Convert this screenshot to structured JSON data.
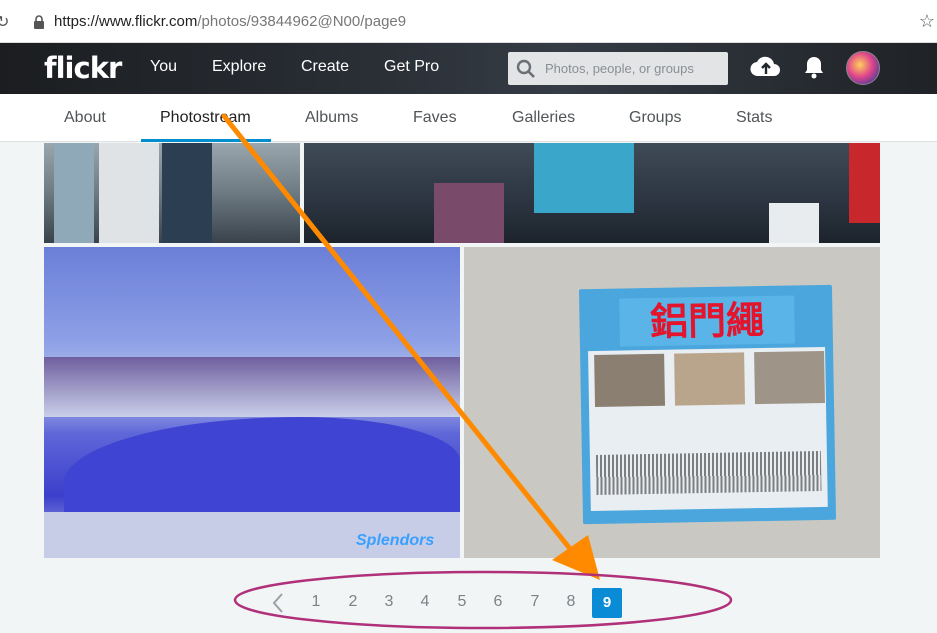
{
  "browser": {
    "url_host": "https://www.flickr.com",
    "url_path": "/photos/93844962@N00/page9"
  },
  "topnav": {
    "logo": "flickr",
    "links": [
      "You",
      "Explore",
      "Create",
      "Get Pro"
    ],
    "search_placeholder": "Photos, people, or groups"
  },
  "subnav": {
    "tabs": [
      "About",
      "Photostream",
      "Albums",
      "Faves",
      "Galleries",
      "Groups",
      "Stats"
    ],
    "active_tab": "Photostream"
  },
  "photos": {
    "package_title": "鋁門繩",
    "watermark": "Splendors"
  },
  "pagination": {
    "pages": [
      "1",
      "2",
      "3",
      "4",
      "5",
      "6",
      "7",
      "8"
    ],
    "current": "9"
  },
  "colors": {
    "accent": "#0a8bd6",
    "annotation_arrow": "#ff8a00",
    "annotation_ellipse": "#b0307a"
  }
}
